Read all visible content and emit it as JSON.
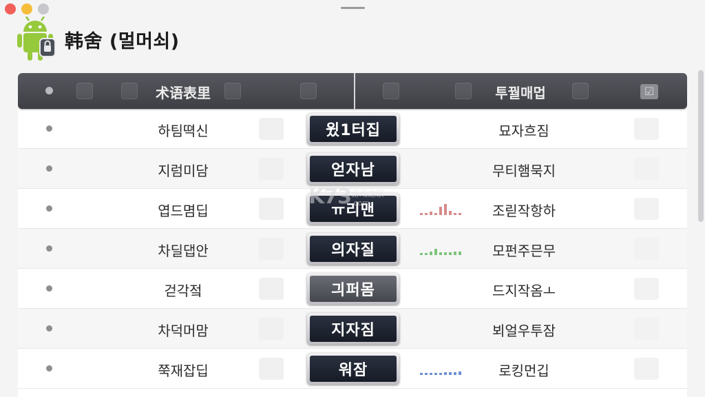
{
  "window": {
    "controls": [
      "close",
      "minimize",
      "zoom"
    ]
  },
  "app": {
    "title": "韩舍 (멀머쇠)",
    "icon": "android-robot-icon"
  },
  "table": {
    "columns": {
      "left": "术语表里",
      "right": "투꿜매멉"
    },
    "header_icons": [
      "users-icon",
      "android-icon",
      "layout-icon",
      "square-icon",
      "search-icon",
      "star-icon",
      "pin-icon",
      "checkbox-icon"
    ],
    "rows": [
      {
        "term": "하팀뗙신",
        "badge": "윘1터집",
        "badge_style": "dark",
        "meaning": "묘자흐짐",
        "signal": null
      },
      {
        "term": "지럼미담",
        "badge": "얻자남",
        "badge_style": "dark",
        "meaning": "무티햄묵지",
        "signal": null
      },
      {
        "term": "엽드몀딥",
        "badge": "ㅠ리맨",
        "badge_style": "dark",
        "meaning": "조릳작항하",
        "signal": "red"
      },
      {
        "term": "차딜댑안",
        "badge": "의자질",
        "badge_style": "dark",
        "meaning": "모펀주믄무",
        "signal": "green"
      },
      {
        "term": "걷각젘",
        "badge": "긔퍼몸",
        "badge_style": "light",
        "meaning": "드지작옴ㅗ",
        "signal": null
      },
      {
        "term": "차덕머맘",
        "badge": "지자짐",
        "badge_style": "dark",
        "meaning": "뵈얼우투잠",
        "signal": null
      },
      {
        "term": "쭉재잡딥",
        "badge": "워잠",
        "badge_style": "dark",
        "meaning": "로킹먼깁",
        "signal": "blue"
      }
    ]
  },
  "watermark": {
    "mark": "K73",
    "text": "游戏之家",
    "url": ".com"
  },
  "colors": {
    "header_bar": "#4a4b51",
    "badge_dark": "#1f2430",
    "signal_red": "#d88a8a",
    "signal_green": "#7cc47a",
    "signal_blue": "#6b8fd0"
  }
}
